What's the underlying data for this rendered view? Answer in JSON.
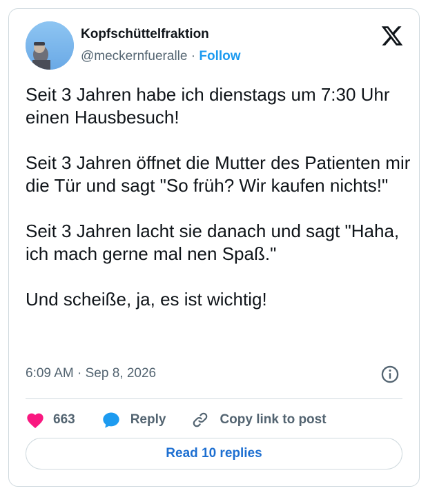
{
  "author": {
    "display_name": "Kopfschüttelfraktion",
    "handle": "@meckernfueralle",
    "separator": "·",
    "follow_label": "Follow"
  },
  "platform_icon": "x-logo-icon",
  "tweet": {
    "paragraphs": [
      "Seit 3 Jahren habe ich dienstags um 7:30 Uhr einen Hausbesuch!",
      "Seit 3 Jahren öffnet die Mutter des Patienten mir die Tür und sagt \"So früh? Wir kaufen nichts!\"",
      "Seit 3 Jahren lacht sie danach und sagt \"Haha, ich mach gerne mal nen Spaß.\"",
      "Und scheiße, ja, es ist wichtig!"
    ],
    "time": "6:09 AM",
    "separator": "·",
    "date": "Sep 8, 2026"
  },
  "actions": {
    "like_count": "663",
    "reply_label": "Reply",
    "copy_link_label": "Copy link to post"
  },
  "read_replies_label": "Read 10 replies",
  "colors": {
    "accent": "#1d9bf0",
    "like": "#f91880",
    "reply_bubble": "#1d9bf0",
    "text": "#0f1419",
    "muted": "#536471",
    "border": "#cfd9de"
  }
}
